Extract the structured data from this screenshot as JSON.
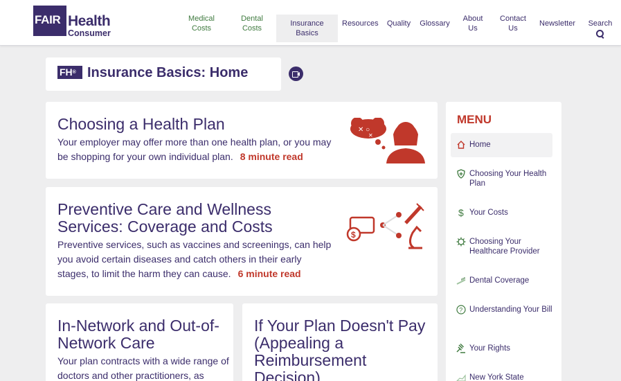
{
  "header": {
    "logo": {
      "fair": "FAIR",
      "health": "Health",
      "consumer": "Consumer"
    },
    "nav": [
      {
        "label": "Medical Costs"
      },
      {
        "label": "Dental Costs"
      },
      {
        "label": "Insurance Basics"
      },
      {
        "label": "Resources"
      },
      {
        "label": "Quality"
      },
      {
        "label": "Glossary"
      },
      {
        "label": "About Us"
      },
      {
        "label": "Contact Us"
      },
      {
        "label": "Newsletter"
      },
      {
        "label": "Search"
      }
    ]
  },
  "page": {
    "badge": "FH",
    "badge_mark": "®",
    "title": "Insurance Basics: Home"
  },
  "cards": [
    {
      "title": "Choosing a Health Plan",
      "body": "Your employer may offer more than one health plan, or you may be shopping for your own individual plan.",
      "read": "8 minute read"
    },
    {
      "title": "Preventive Care and Wellness Services: Coverage and Costs",
      "body": "Preventive services, such as vaccines and screenings, can help you avoid certain diseases and catch others in their early stages, to limit the harm they can cause.",
      "read": "6 minute read"
    },
    {
      "title": "In-Network and Out-of-Network Care",
      "body": "Your plan contracts with a wide range of doctors and other practitioners, as"
    },
    {
      "title": "If Your Plan Doesn't Pay (Appealing a Reimbursement Decision)"
    }
  ],
  "menu": {
    "heading": "MENU",
    "items": [
      {
        "label": "Home",
        "icon": "home-icon"
      },
      {
        "label": "Choosing Your Health Plan",
        "icon": "shield-plus-icon"
      },
      {
        "label": "Your Costs",
        "icon": "dollar-icon"
      },
      {
        "label": "Choosing Your Healthcare Provider",
        "icon": "virus-icon"
      },
      {
        "label": "Dental Coverage",
        "icon": "toothbrush-icon"
      },
      {
        "label": "Understanding Your Bill",
        "icon": "question-icon"
      },
      {
        "label": "Your Rights",
        "icon": "gavel-icon"
      },
      {
        "label": "New York State",
        "icon": "map-icon"
      }
    ]
  },
  "colors": {
    "brand": "#3b2d6b",
    "accent": "#c0382b",
    "green": "#3f7a3f"
  }
}
